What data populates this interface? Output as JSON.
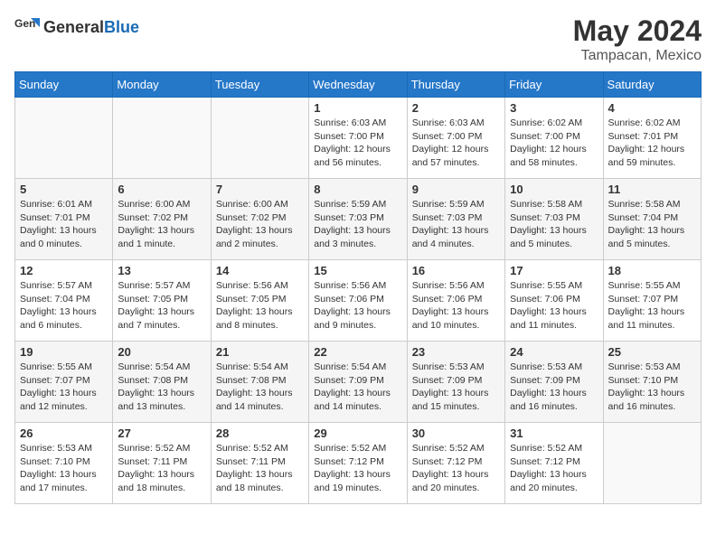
{
  "header": {
    "logo_general": "General",
    "logo_blue": "Blue",
    "month_year": "May 2024",
    "location": "Tampacan, Mexico"
  },
  "weekdays": [
    "Sunday",
    "Monday",
    "Tuesday",
    "Wednesday",
    "Thursday",
    "Friday",
    "Saturday"
  ],
  "weeks": [
    [
      {
        "day": "",
        "info": ""
      },
      {
        "day": "",
        "info": ""
      },
      {
        "day": "",
        "info": ""
      },
      {
        "day": "1",
        "info": "Sunrise: 6:03 AM\nSunset: 7:00 PM\nDaylight: 12 hours\nand 56 minutes."
      },
      {
        "day": "2",
        "info": "Sunrise: 6:03 AM\nSunset: 7:00 PM\nDaylight: 12 hours\nand 57 minutes."
      },
      {
        "day": "3",
        "info": "Sunrise: 6:02 AM\nSunset: 7:00 PM\nDaylight: 12 hours\nand 58 minutes."
      },
      {
        "day": "4",
        "info": "Sunrise: 6:02 AM\nSunset: 7:01 PM\nDaylight: 12 hours\nand 59 minutes."
      }
    ],
    [
      {
        "day": "5",
        "info": "Sunrise: 6:01 AM\nSunset: 7:01 PM\nDaylight: 13 hours\nand 0 minutes."
      },
      {
        "day": "6",
        "info": "Sunrise: 6:00 AM\nSunset: 7:02 PM\nDaylight: 13 hours\nand 1 minute."
      },
      {
        "day": "7",
        "info": "Sunrise: 6:00 AM\nSunset: 7:02 PM\nDaylight: 13 hours\nand 2 minutes."
      },
      {
        "day": "8",
        "info": "Sunrise: 5:59 AM\nSunset: 7:03 PM\nDaylight: 13 hours\nand 3 minutes."
      },
      {
        "day": "9",
        "info": "Sunrise: 5:59 AM\nSunset: 7:03 PM\nDaylight: 13 hours\nand 4 minutes."
      },
      {
        "day": "10",
        "info": "Sunrise: 5:58 AM\nSunset: 7:03 PM\nDaylight: 13 hours\nand 5 minutes."
      },
      {
        "day": "11",
        "info": "Sunrise: 5:58 AM\nSunset: 7:04 PM\nDaylight: 13 hours\nand 5 minutes."
      }
    ],
    [
      {
        "day": "12",
        "info": "Sunrise: 5:57 AM\nSunset: 7:04 PM\nDaylight: 13 hours\nand 6 minutes."
      },
      {
        "day": "13",
        "info": "Sunrise: 5:57 AM\nSunset: 7:05 PM\nDaylight: 13 hours\nand 7 minutes."
      },
      {
        "day": "14",
        "info": "Sunrise: 5:56 AM\nSunset: 7:05 PM\nDaylight: 13 hours\nand 8 minutes."
      },
      {
        "day": "15",
        "info": "Sunrise: 5:56 AM\nSunset: 7:06 PM\nDaylight: 13 hours\nand 9 minutes."
      },
      {
        "day": "16",
        "info": "Sunrise: 5:56 AM\nSunset: 7:06 PM\nDaylight: 13 hours\nand 10 minutes."
      },
      {
        "day": "17",
        "info": "Sunrise: 5:55 AM\nSunset: 7:06 PM\nDaylight: 13 hours\nand 11 minutes."
      },
      {
        "day": "18",
        "info": "Sunrise: 5:55 AM\nSunset: 7:07 PM\nDaylight: 13 hours\nand 11 minutes."
      }
    ],
    [
      {
        "day": "19",
        "info": "Sunrise: 5:55 AM\nSunset: 7:07 PM\nDaylight: 13 hours\nand 12 minutes."
      },
      {
        "day": "20",
        "info": "Sunrise: 5:54 AM\nSunset: 7:08 PM\nDaylight: 13 hours\nand 13 minutes."
      },
      {
        "day": "21",
        "info": "Sunrise: 5:54 AM\nSunset: 7:08 PM\nDaylight: 13 hours\nand 14 minutes."
      },
      {
        "day": "22",
        "info": "Sunrise: 5:54 AM\nSunset: 7:09 PM\nDaylight: 13 hours\nand 14 minutes."
      },
      {
        "day": "23",
        "info": "Sunrise: 5:53 AM\nSunset: 7:09 PM\nDaylight: 13 hours\nand 15 minutes."
      },
      {
        "day": "24",
        "info": "Sunrise: 5:53 AM\nSunset: 7:09 PM\nDaylight: 13 hours\nand 16 minutes."
      },
      {
        "day": "25",
        "info": "Sunrise: 5:53 AM\nSunset: 7:10 PM\nDaylight: 13 hours\nand 16 minutes."
      }
    ],
    [
      {
        "day": "26",
        "info": "Sunrise: 5:53 AM\nSunset: 7:10 PM\nDaylight: 13 hours\nand 17 minutes."
      },
      {
        "day": "27",
        "info": "Sunrise: 5:52 AM\nSunset: 7:11 PM\nDaylight: 13 hours\nand 18 minutes."
      },
      {
        "day": "28",
        "info": "Sunrise: 5:52 AM\nSunset: 7:11 PM\nDaylight: 13 hours\nand 18 minutes."
      },
      {
        "day": "29",
        "info": "Sunrise: 5:52 AM\nSunset: 7:12 PM\nDaylight: 13 hours\nand 19 minutes."
      },
      {
        "day": "30",
        "info": "Sunrise: 5:52 AM\nSunset: 7:12 PM\nDaylight: 13 hours\nand 20 minutes."
      },
      {
        "day": "31",
        "info": "Sunrise: 5:52 AM\nSunset: 7:12 PM\nDaylight: 13 hours\nand 20 minutes."
      },
      {
        "day": "",
        "info": ""
      }
    ]
  ]
}
